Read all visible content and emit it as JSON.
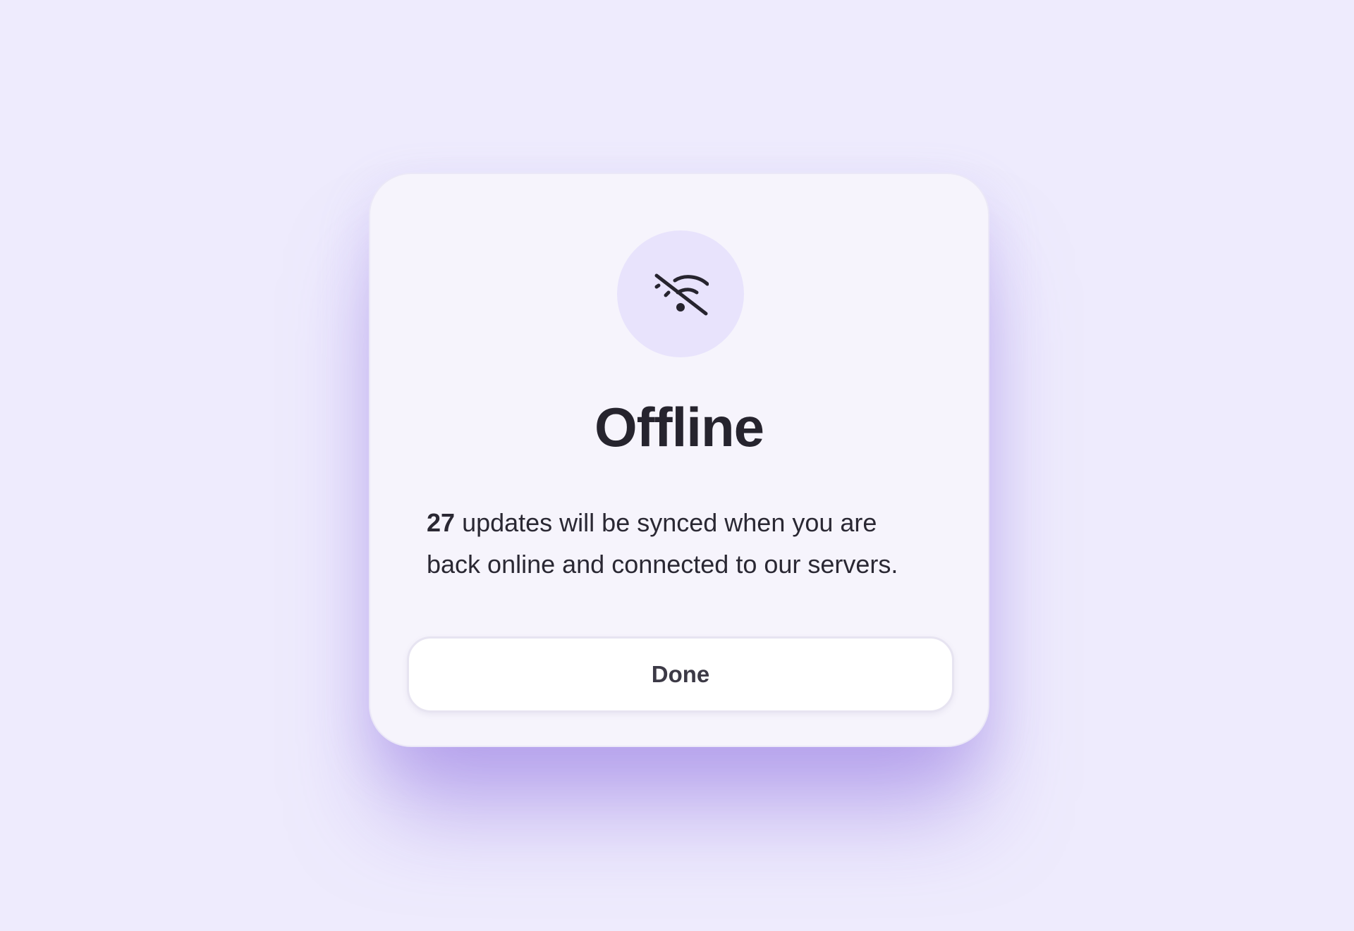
{
  "dialog": {
    "icon": "wifi-off-icon",
    "title": "Offline",
    "message_count": "27",
    "message_text": "updates will be synced when you are back online and connected to our servers.",
    "button_label": "Done"
  },
  "colors": {
    "background": "#eeebfd",
    "card": "#f6f4fc",
    "icon_circle": "#e8e3fc",
    "text": "#26242e",
    "button_bg": "#ffffff",
    "button_text": "#3c3a46"
  }
}
